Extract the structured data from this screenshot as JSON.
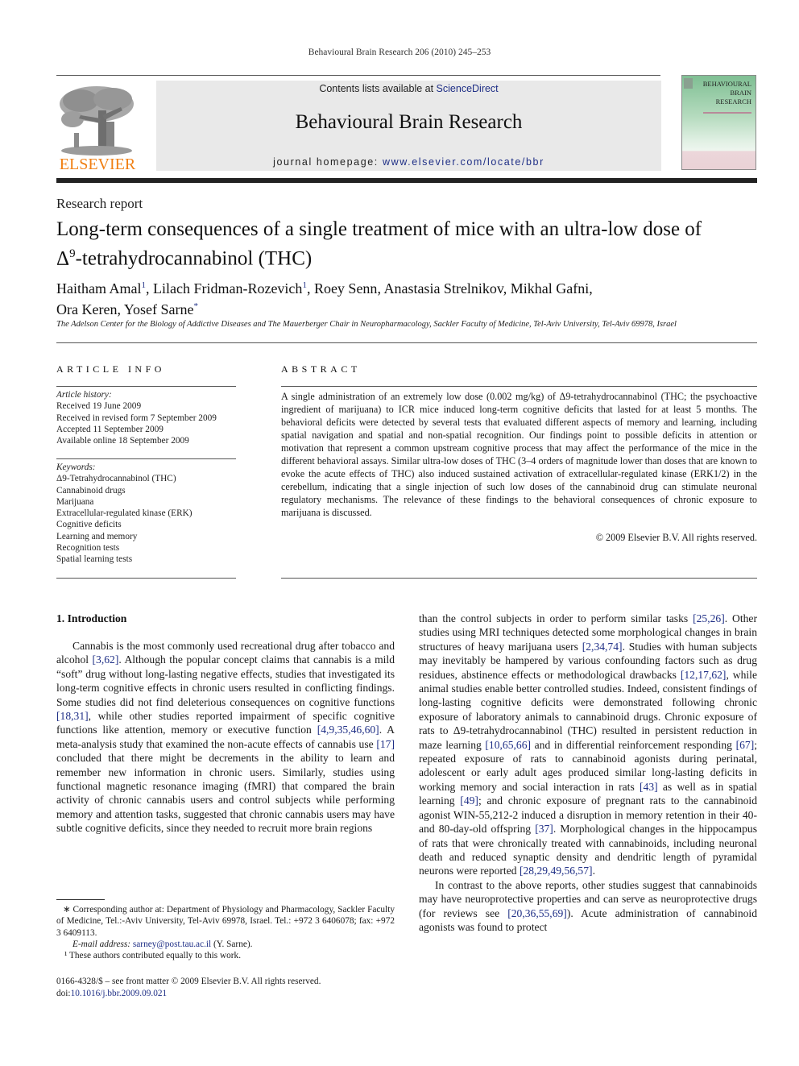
{
  "running_head": "Behavioural Brain Research 206 (2010) 245–253",
  "masthead": {
    "publisher_logo_text": "ELSEVIER",
    "contents_prefix": "Contents lists available at ",
    "contents_link": "ScienceDirect",
    "journal_name": "Behavioural Brain Research",
    "homepage_prefix": "journal homepage: ",
    "homepage_link": "www.elsevier.com/locate/bbr",
    "cover_title_lines": [
      "BEHAVIOURAL",
      "BRAIN",
      "RESEARCH"
    ],
    "colors": {
      "elsevier_orange": "#f07f13",
      "link_blue": "#1f2f86",
      "masthead_gray": "#e9e9e9"
    }
  },
  "article": {
    "section_type": "Research report",
    "title_line1": "Long-term consequences of a single treatment of mice with an ultra-low dose of",
    "title_delta": "Δ",
    "title_sup": "9",
    "title_line2_rest": "-tetrahydrocannabinol (THC)",
    "authors": [
      {
        "name": "Haitham Amal",
        "mark": "1",
        "sep": ", "
      },
      {
        "name": "Lilach Fridman-Rozevich",
        "mark": "1",
        "sep": ", "
      },
      {
        "name": "Roey Senn",
        "mark": "",
        "sep": ", "
      },
      {
        "name": "Anastasia Strelnikov",
        "mark": "",
        "sep": ", "
      },
      {
        "name": "Mikhal Gafni",
        "mark": "",
        "sep": ","
      },
      {
        "name": "Ora Keren",
        "mark": "",
        "sep": ", "
      },
      {
        "name": "Yosef Sarne",
        "mark": "*",
        "sep": ""
      }
    ],
    "affiliation": "The Adelson Center for the Biology of Addictive Diseases and The Mauerberger Chair in Neuropharmacology, Sackler Faculty of Medicine, Tel-Aviv University, Tel-Aviv 69978, Israel"
  },
  "article_info": {
    "heading": "ARTICLE INFO",
    "history_label": "Article history:",
    "history": [
      "Received 19 June 2009",
      "Received in revised form 7 September 2009",
      "Accepted 11 September 2009",
      "Available online 18 September 2009"
    ],
    "keywords_label": "Keywords:",
    "keywords": [
      "Δ9-Tetrahydrocannabinol (THC)",
      "Cannabinoid drugs",
      "Marijuana",
      "Extracellular-regulated kinase (ERK)",
      "Cognitive deficits",
      "Learning and memory",
      "Recognition tests",
      "Spatial learning tests"
    ]
  },
  "abstract": {
    "heading": "ABSTRACT",
    "text": "A single administration of an extremely low dose (0.002 mg/kg) of Δ9-tetrahydrocannabinol (THC; the psychoactive ingredient of marijuana) to ICR mice induced long-term cognitive deficits that lasted for at least 5 months. The behavioral deficits were detected by several tests that evaluated different aspects of memory and learning, including spatial navigation and spatial and non-spatial recognition. Our findings point to possible deficits in attention or motivation that represent a common upstream cognitive process that may affect the performance of the mice in the different behavioral assays. Similar ultra-low doses of THC (3–4 orders of magnitude lower than doses that are known to evoke the acute effects of THC) also induced sustained activation of extracellular-regulated kinase (ERK1/2) in the cerebellum, indicating that a single injection of such low doses of the cannabinoid drug can stimulate neuronal regulatory mechanisms. The relevance of these findings to the behavioral consequences of chronic exposure to marijuana is discussed.",
    "copyright": "© 2009 Elsevier B.V. All rights reserved."
  },
  "introduction": {
    "heading": "1.  Introduction",
    "left_column": [
      {
        "t": "Cannabis is the most commonly used recreational drug after tobacco and alcohol "
      },
      {
        "ref": "[3,62]"
      },
      {
        "t": ". Although the popular concept claims that cannabis is a mild “soft” drug without long-lasting negative effects, studies that investigated its long-term cognitive effects in chronic users resulted in conflicting findings. Some studies did not find deleterious consequences on cognitive functions "
      },
      {
        "ref": "[18,31]"
      },
      {
        "t": ", while other studies reported impairment of specific cognitive functions like attention, memory or executive function "
      },
      {
        "ref": "[4,9,35,46,60]"
      },
      {
        "t": ". A meta-analysis study that examined the non-acute effects of cannabis use "
      },
      {
        "ref": "[17]"
      },
      {
        "t": " concluded that there might be decrements in the ability to learn and remember new information in chronic users. Similarly, studies using functional magnetic resonance imaging (fMRI) that compared the brain activity of chronic cannabis users and control subjects while performing memory and attention tasks, suggested that chronic cannabis users may have subtle cognitive deficits, since they needed to recruit more brain regions"
      }
    ],
    "right_column_p1": [
      {
        "t": "than the control subjects in order to perform similar tasks "
      },
      {
        "ref": "[25,26]"
      },
      {
        "t": ". Other studies using MRI techniques detected some morphological changes in brain structures of heavy marijuana users "
      },
      {
        "ref": "[2,34,74]"
      },
      {
        "t": ". Studies with human subjects may inevitably be hampered by various confounding factors such as drug residues, abstinence effects or methodological drawbacks "
      },
      {
        "ref": "[12,17,62]"
      },
      {
        "t": ", while animal studies enable better controlled studies. Indeed, consistent findings of long-lasting cognitive deficits were demonstrated following chronic exposure of laboratory animals to cannabinoid drugs. Chronic exposure of rats to Δ9-tetrahydrocannabinol (THC) resulted in persistent reduction in maze learning "
      },
      {
        "ref": "[10,65,66]"
      },
      {
        "t": " and in differential reinforcement responding "
      },
      {
        "ref": "[67]"
      },
      {
        "t": "; repeated exposure of rats to cannabinoid agonists during perinatal, adolescent or early adult ages produced similar long-lasting deficits in working memory and social interaction in rats "
      },
      {
        "ref": "[43]"
      },
      {
        "t": " as well as in spatial learning "
      },
      {
        "ref": "[49]"
      },
      {
        "t": "; and chronic exposure of pregnant rats to the cannabinoid agonist WIN-55,212-2 induced a disruption in memory retention in their 40- and 80-day-old offspring "
      },
      {
        "ref": "[37]"
      },
      {
        "t": ". Morphological changes in the hippocampus of rats that were chronically treated with cannabinoids, including neuronal death and reduced synaptic density and dendritic length of pyramidal neurons were reported "
      },
      {
        "ref": "[28,29,49,56,57]"
      },
      {
        "t": "."
      }
    ],
    "right_column_p2": [
      {
        "t": "In contrast to the above reports, other studies suggest that cannabinoids may have neuroprotective properties and can serve as neuroprotective drugs (for reviews see "
      },
      {
        "ref": "[20,36,55,69]"
      },
      {
        "t": "). Acute administration of cannabinoid agonists was found to protect"
      }
    ]
  },
  "footnotes": {
    "corresponding": "∗  Corresponding author at: Department of Physiology and Pharmacology, Sackler Faculty of Medicine, Tel.:-Aviv University, Tel-Aviv 69978, Israel. Tel.: +972 3 6406078; fax: +972 3 6409113.",
    "email_label": "E-mail address: ",
    "email": "sarney@post.tau.ac.il",
    "email_suffix": " (Y. Sarne).",
    "equal_contrib": "¹ These authors contributed equally to this work."
  },
  "front_matter": {
    "issn_line": "0166-4328/$ – see front matter © 2009 Elsevier B.V. All rights reserved.",
    "doi_prefix": "doi:",
    "doi": "10.1016/j.bbr.2009.09.021"
  }
}
